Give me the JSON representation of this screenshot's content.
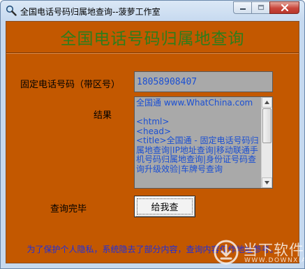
{
  "window": {
    "title": "全国电话号码归属地查询--菠萝工作室"
  },
  "heading": "全国电话号码归属地查询",
  "form": {
    "phone_label": "固定电话号码（带区号）",
    "phone_value": "18058908407",
    "result_label": "结果",
    "result_text": "全国通 www.WhatChina.com\n\n<html>\n<head>\n<title>全国通 - 固定电话号码归属地查询|IP地址查询|移动联通手机号码归属地查询|身份证号码查询升级效验|车牌号查询",
    "status_text": "查询完毕",
    "query_button_label": "给我查"
  },
  "notice": "为了保护个人隐私，系统隐去了部分内容，查询内容仅作地址参考。",
  "watermark": {
    "text": "当下软件园",
    "url": "WWW.DOWNXIA.COM"
  },
  "colors": {
    "client_background": "#c35800",
    "heading": "#2e7d1b",
    "input_background": "#a9a9a9",
    "input_text": "#1a4fd3",
    "notice_text": "#1d2fe0"
  },
  "icons": {
    "app": "magnifier-icon",
    "minimize": "minimize-icon",
    "maximize": "maximize-icon",
    "close": "close-icon"
  }
}
